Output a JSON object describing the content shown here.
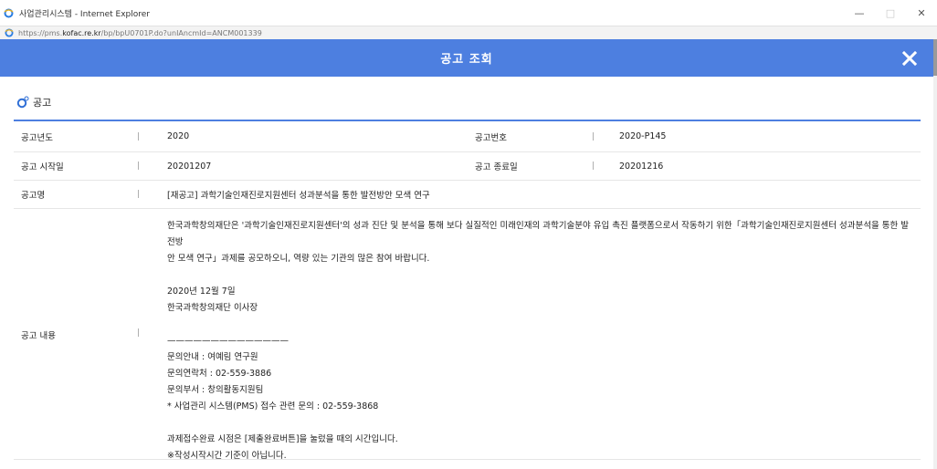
{
  "window": {
    "title": "사업관리시스템 - Internet Explorer",
    "url_prefix": "https://pms.",
    "url_host": "kofac.re.kr",
    "url_path": "/bp/bpU0701P.do?unIAncmId=ANCM001339",
    "minimize_glyph": "—",
    "maximize_glyph": "□",
    "close_glyph": "✕"
  },
  "header": {
    "title": "공고 조회",
    "accent_color": "#4d7fe0"
  },
  "section": {
    "title": "공고"
  },
  "details": {
    "separator": "|",
    "year_label": "공고년도",
    "year_value": "2020",
    "number_label": "공고번호",
    "number_value": "2020-P145",
    "start_label": "공고 시작일",
    "start_value": "20201207",
    "end_label": "공고 종료일",
    "end_value": "20201216",
    "name_label": "공고명",
    "name_value": "[재공고] 과학기술인재진로지원센터 성과분석을 통한 발전방안 모색 연구",
    "content_label": "공고 내용"
  },
  "content": {
    "para1_line1": "한국과학창의재단은 '과학기술인재진로지원센터'의 성과 진단 및 분석을 통해 보다 실질적인 미래인재의 과학기술분야 유입 촉진 플랫폼으로서 작동하기 위한「과학기술인재진로지원센터 성과분석을 통한 발전방",
    "para1_line2": "안 모색 연구」과제를 공모하오니, 역량 있는 기관의 많은 참여 바랍니다.",
    "date": "2020년 12월 7일",
    "signer": "한국과학창의재단 이사장",
    "divider": "——————————————",
    "contact_person": "문의안내 : 여예림 연구원",
    "contact_phone": "문의연락처 : 02-559-3886",
    "contact_dept": "문의부서 : 창의활동지원팀",
    "pms_contact": "* 사업관리 시스템(PMS) 접수 관련 문의 : 02-559-3868",
    "note1": "과제접수완료 시점은 [제출완료버튼]을 눌렀을 때의 시간입니다.",
    "note2": "※작성시작시간 기준이 아닙니다."
  }
}
